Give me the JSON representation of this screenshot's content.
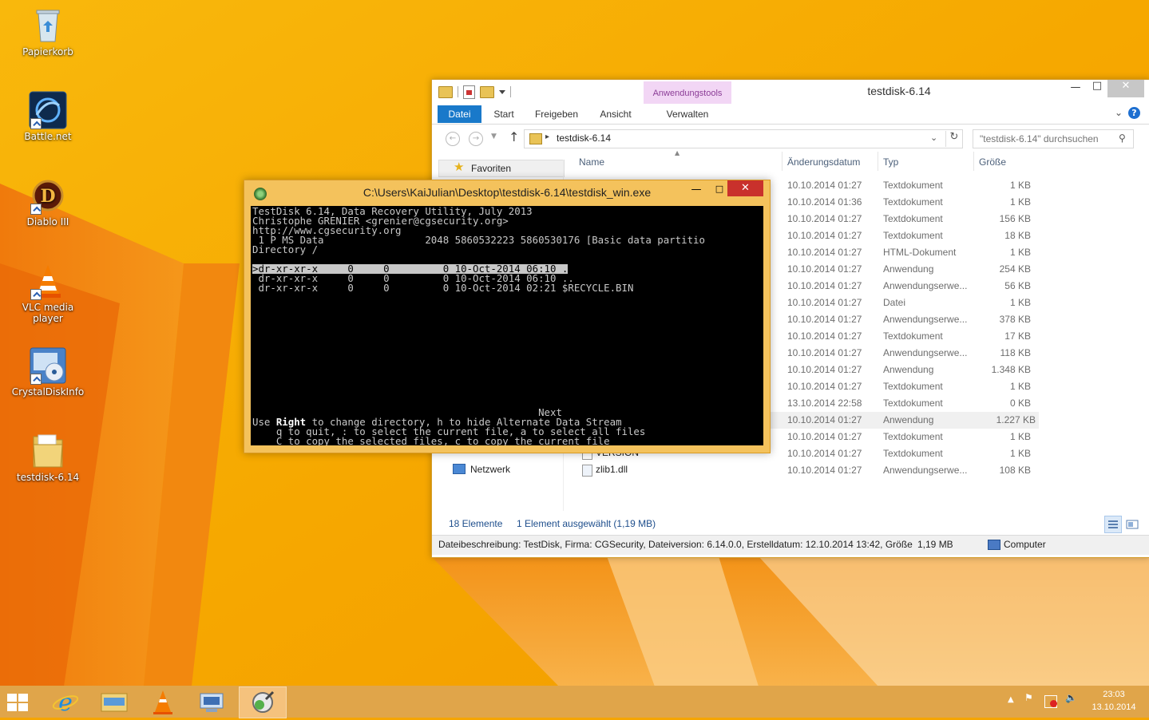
{
  "desktop": {
    "icons": [
      {
        "label": "Papierkorb"
      },
      {
        "label": "Battle.net"
      },
      {
        "label": "Diablo III"
      },
      {
        "label": "VLC media player"
      },
      {
        "label": "CrystalDiskInfo"
      },
      {
        "label": "testdisk-6.14"
      }
    ]
  },
  "explorer": {
    "title": "testdisk-6.14",
    "context_tab": "Anwendungstools",
    "ribbon_tabs": {
      "file": "Datei",
      "start": "Start",
      "share": "Freigeben",
      "view": "Ansicht",
      "manage": "Verwalten"
    },
    "address": "testdisk-6.14",
    "search_placeholder": "\"testdisk-6.14\" durchsuchen",
    "nav": {
      "favorites": "Favoriten",
      "network": "Netzwerk"
    },
    "columns": {
      "name": "Name",
      "date": "Änderungsdatum",
      "type": "Typ",
      "size": "Größe"
    },
    "visible_names": [
      "VERSION",
      "zlib1.dll"
    ],
    "rows": [
      {
        "date": "10.10.2014 01:27",
        "type": "Textdokument",
        "size": "1 KB"
      },
      {
        "date": "10.10.2014 01:36",
        "type": "Textdokument",
        "size": "1 KB"
      },
      {
        "date": "10.10.2014 01:27",
        "type": "Textdokument",
        "size": "156 KB"
      },
      {
        "date": "10.10.2014 01:27",
        "type": "Textdokument",
        "size": "18 KB"
      },
      {
        "date": "10.10.2014 01:27",
        "type": "HTML-Dokument",
        "size": "1 KB"
      },
      {
        "date": "10.10.2014 01:27",
        "type": "Anwendung",
        "size": "254 KB"
      },
      {
        "date": "10.10.2014 01:27",
        "type": "Anwendungserwe...",
        "size": "56 KB"
      },
      {
        "date": "10.10.2014 01:27",
        "type": "Datei",
        "size": "1 KB"
      },
      {
        "date": "10.10.2014 01:27",
        "type": "Anwendungserwe...",
        "size": "378 KB"
      },
      {
        "date": "10.10.2014 01:27",
        "type": "Textdokument",
        "size": "17 KB"
      },
      {
        "date": "10.10.2014 01:27",
        "type": "Anwendungserwe...",
        "size": "118 KB"
      },
      {
        "date": "10.10.2014 01:27",
        "type": "Anwendung",
        "size": "1.348 KB"
      },
      {
        "date": "10.10.2014 01:27",
        "type": "Textdokument",
        "size": "1 KB"
      },
      {
        "date": "13.10.2014 22:58",
        "type": "Textdokument",
        "size": "0 KB"
      },
      {
        "date": "10.10.2014 01:27",
        "type": "Anwendung",
        "size": "1.227 KB"
      },
      {
        "date": "10.10.2014 01:27",
        "type": "Textdokument",
        "size": "1 KB"
      },
      {
        "date": "10.10.2014 01:27",
        "type": "Textdokument",
        "size": "1 KB"
      },
      {
        "date": "10.10.2014 01:27",
        "type": "Anwendungserwe...",
        "size": "108 KB"
      }
    ],
    "status": {
      "count": "18 Elemente",
      "selected": "1 Element ausgewählt (1,19 MB)"
    },
    "details": {
      "description": "Dateibeschreibung: TestDisk, Firma: CGSecurity, Dateiversion: 6.14.0.0, Erstelldatum: 12.10.2014 13:42, Größe: 1,19",
      "size": "1,19 MB",
      "location": "Computer"
    }
  },
  "console": {
    "title": "C:\\Users\\KaiJulian\\Desktop\\testdisk-6.14\\testdisk_win.exe",
    "lines": [
      "TestDisk 6.14, Data Recovery Utility, July 2013",
      "Christophe GRENIER <grenier@cgsecurity.org>",
      "http://www.cgsecurity.org",
      " 1 P MS Data                 2048 5860532223 5860530176 [Basic data partitio",
      "Directory /",
      ">dr-xr-xr-x     0     0         0 10-Oct-2014 06:10 .",
      " dr-xr-xr-x     0     0         0 10-Oct-2014 06:10 ..",
      " dr-xr-xr-x     0     0         0 10-Oct-2014 02:21 $RECYCLE.BIN",
      "                                                Next",
      "Use Right to change directory, h to hide Alternate Data Stream",
      "    q to quit, : to select the current file, a to select all files",
      "    C to copy the selected files, c to copy the current file"
    ],
    "help_prefix": "Use ",
    "help_key": "Right",
    "help_rest": " to change directory, h to hide Alternate Data Stream"
  },
  "taskbar": {
    "time": "23:03",
    "date": "13.10.2014"
  }
}
